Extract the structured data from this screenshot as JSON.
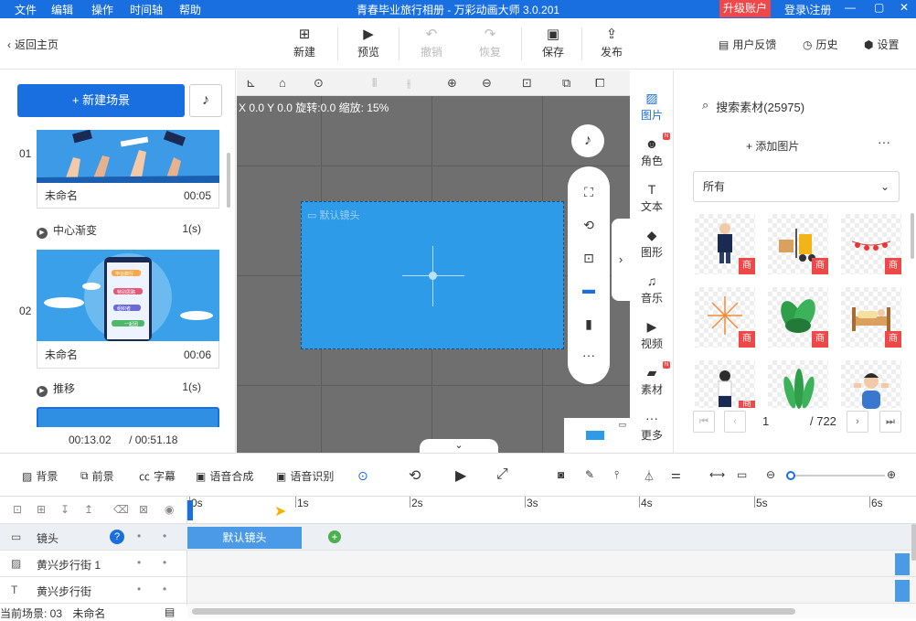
{
  "titlebar": {
    "menus": [
      "文件",
      "编辑",
      "操作",
      "时间轴",
      "帮助"
    ],
    "title": "青春毕业旅行相册 - 万彩动画大师 3.0.201",
    "upgrade": "升级账户",
    "login": "登录\\注册",
    "min": "—",
    "max": "▢",
    "close": "✕",
    "brand_color": "#1a6fe0"
  },
  "toolbar": {
    "back": "返回主页",
    "new": "新建",
    "preview": "预览",
    "undo": "撤销",
    "redo": "恢复",
    "save": "保存",
    "publish": "发布",
    "feedback": "用户反馈",
    "history": "历史",
    "settings": "设置"
  },
  "left": {
    "new_scene": "+ 新建场景",
    "scenes": [
      {
        "no": "01",
        "name": "未命名",
        "duration": "00:05",
        "transition": "中心渐变",
        "trans_dur": "1(s)"
      },
      {
        "no": "02",
        "name": "未命名",
        "duration": "00:06",
        "transition": "推移",
        "trans_dur": "1(s)"
      }
    ],
    "thumb2_labels": [
      "毕业旅行",
      "特别思路",
      "组织者",
      "一起团"
    ],
    "current_time": "00:13.02",
    "total_time": "/ 00:51.18"
  },
  "canvas": {
    "coord": "X 0.0 Y 0.0 旋转:0.0 缩放: 15%",
    "camera_label": "默认镜头",
    "bg_color": "#6f6f6f",
    "stage_color": "#2d9be8"
  },
  "rtabs": [
    {
      "label": "图片",
      "icon": "image-icon"
    },
    {
      "label": "角色",
      "icon": "person-icon",
      "badge": "N"
    },
    {
      "label": "文本",
      "icon": "text-icon"
    },
    {
      "label": "图形",
      "icon": "shape-icon"
    },
    {
      "label": "音乐",
      "icon": "music-icon"
    },
    {
      "label": "视频",
      "icon": "video-icon"
    },
    {
      "label": "素材",
      "icon": "folder-icon",
      "badge": "N"
    },
    {
      "label": "更多",
      "icon": "more-icon"
    }
  ],
  "assets": {
    "search": "搜索素材(25975)",
    "add_image": "+ 添加图片",
    "filter": "所有",
    "badge": "商",
    "page": "1",
    "total_pages": "/ 722"
  },
  "timeline": {
    "buttons": [
      "背景",
      "前景",
      "字幕",
      "语音合成",
      "语音识别"
    ],
    "ruler": [
      "0s",
      "1s",
      "2s",
      "3s",
      "4s",
      "5s",
      "6s"
    ],
    "tracks": [
      "镜头",
      "黄兴步行街 1",
      "黄兴步行街"
    ],
    "clip": "默认镜头",
    "status_scene": "当前场景: 03",
    "status_name": "未命名"
  }
}
